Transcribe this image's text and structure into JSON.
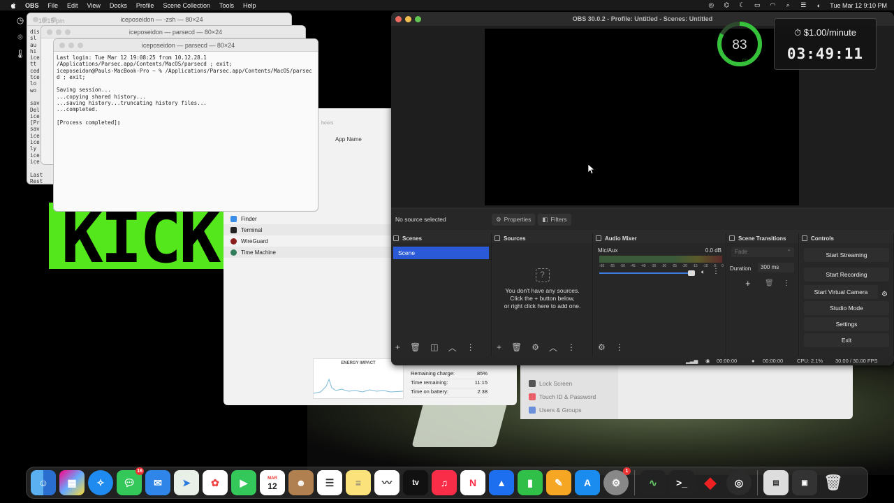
{
  "menubar": {
    "app": "OBS",
    "items": [
      "File",
      "Edit",
      "View",
      "Docks",
      "Profile",
      "Scene Collection",
      "Tools",
      "Help"
    ],
    "datetime": "Tue Mar 12  9:10 PM"
  },
  "terminals": {
    "back2_title": "iceposeidon — -zsh — 80×24",
    "back1_title": "iceposeidon — parsecd — 80×24",
    "front_title": "iceposeidon — parsecd — 80×24",
    "front_lines": [
      "Last login: Tue Mar 12 19:08:25 from 10.12.28.1",
      "/Applications/Parsec.app/Contents/MacOS/parsecd ; exit;",
      "iceposeidon@Pauls-MacBook-Pro ~ % /Applications/Parsec.app/Contents/MacOS/parsec",
      "d ; exit;",
      "",
      "Saving session...",
      "...copying shared history...",
      "...saving history...truncating history files...",
      "...completed.",
      "",
      "[Process completed]"
    ],
    "back_clock": "10:15 pm"
  },
  "kick_text": "KICK",
  "activity": {
    "hours_label": "hours",
    "col_app_name": "App Name",
    "apps": [
      "Finder",
      "Terminal",
      "WireGuard",
      "Time Machine"
    ],
    "energy_title": "ENERGY IMPACT",
    "battery": [
      {
        "label": "Remaining charge:",
        "value": "85%"
      },
      {
        "label": "Time remaining:",
        "value": "11:15"
      },
      {
        "label": "Time on battery:",
        "value": "2:38"
      }
    ]
  },
  "settings_bg": {
    "items": [
      "Lock Screen",
      "Touch ID & Password",
      "Users & Groups"
    ]
  },
  "obs": {
    "title": "OBS 30.0.2 - Profile: Untitled - Scenes: Untitled",
    "no_source": "No source selected",
    "properties": "Properties",
    "filters": "Filters",
    "docks": {
      "scenes": "Scenes",
      "sources": "Sources",
      "audio_mixer": "Audio Mixer",
      "scene_transitions": "Scene Transitions",
      "controls": "Controls"
    },
    "scene_item": "Scene",
    "sources_empty": [
      "You don't have any sources.",
      "Click the + button below,",
      "or right click here to add one."
    ],
    "mixer": {
      "channel": "Mic/Aux",
      "db": "0.0 dB",
      "ticks": [
        "-60",
        "-55",
        "-50",
        "-45",
        "-40",
        "-35",
        "-30",
        "-25",
        "-20",
        "-15",
        "-10",
        "-5",
        "0"
      ],
      "volume_fraction": 0.88
    },
    "transitions": {
      "type": "Fade",
      "duration_label": "Duration",
      "duration_value": "300 ms"
    },
    "controls": [
      "Start Streaming",
      "Start Recording",
      "Start Virtual Camera",
      "Studio Mode",
      "Settings",
      "Exit"
    ],
    "status": {
      "stream_time": "00:00:00",
      "rec_time": "00:00:00",
      "cpu": "CPU: 2.1%",
      "fps": "30.00 / 30.00 FPS"
    }
  },
  "overlay": {
    "ring_value": "83",
    "ring_fraction": 0.83,
    "rate": "$1.00/minute",
    "timer": "03:49:11"
  },
  "dock": {
    "messages_badge": "16",
    "calendar_month": "MAR",
    "calendar_day": "12",
    "settings_badge": "1",
    "appletv_label": "tv"
  }
}
